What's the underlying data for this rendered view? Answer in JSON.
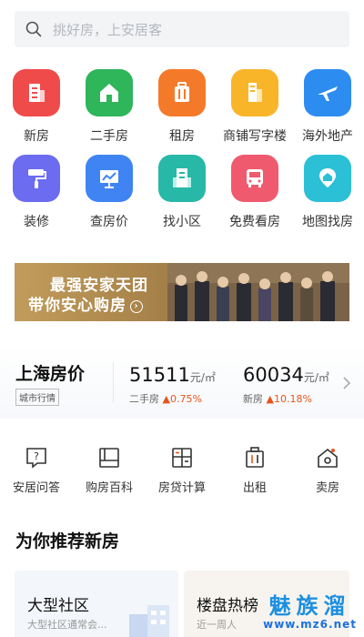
{
  "search": {
    "placeholder": "挑好房，上安居客"
  },
  "grid": {
    "row1": [
      {
        "label": "新房",
        "color": "#f04b4b"
      },
      {
        "label": "二手房",
        "color": "#2fb55a"
      },
      {
        "label": "租房",
        "color": "#f47a2a"
      },
      {
        "label": "商铺写字楼",
        "color": "#f9b52a"
      },
      {
        "label": "海外地产",
        "color": "#2d8cf0"
      }
    ],
    "row2": [
      {
        "label": "装修",
        "color": "#6b6cf0"
      },
      {
        "label": "查房价",
        "color": "#3f84f2"
      },
      {
        "label": "找小区",
        "color": "#28b8a8"
      },
      {
        "label": "免费看房",
        "color": "#f05a6e"
      },
      {
        "label": "地图找房",
        "color": "#2cc0d6"
      }
    ]
  },
  "banner": {
    "line1": "最强安家天团",
    "line2": "带你安心购房"
  },
  "price": {
    "city": "上海房价",
    "tag": "城市行情",
    "second_hand": {
      "value": "51511",
      "unit": "元/㎡",
      "label": "二手房",
      "change": "▲0.75%"
    },
    "new_house": {
      "value": "60034",
      "unit": "元/㎡",
      "label": "新房",
      "change": "▲10.18%"
    }
  },
  "tools": [
    {
      "label": "安居问答"
    },
    {
      "label": "购房百科"
    },
    {
      "label": "房贷计算"
    },
    {
      "label": "出租"
    },
    {
      "label": "卖房"
    }
  ],
  "recommend": {
    "title": "为你推荐新房",
    "card1": {
      "title": "大型社区",
      "subtitle": "大型社区通常会..."
    },
    "card2": {
      "title": "楼盘热榜",
      "subtitle": "近一周人"
    }
  },
  "watermark": {
    "line1": "魅族溜",
    "line2": "www.mz6.net"
  }
}
